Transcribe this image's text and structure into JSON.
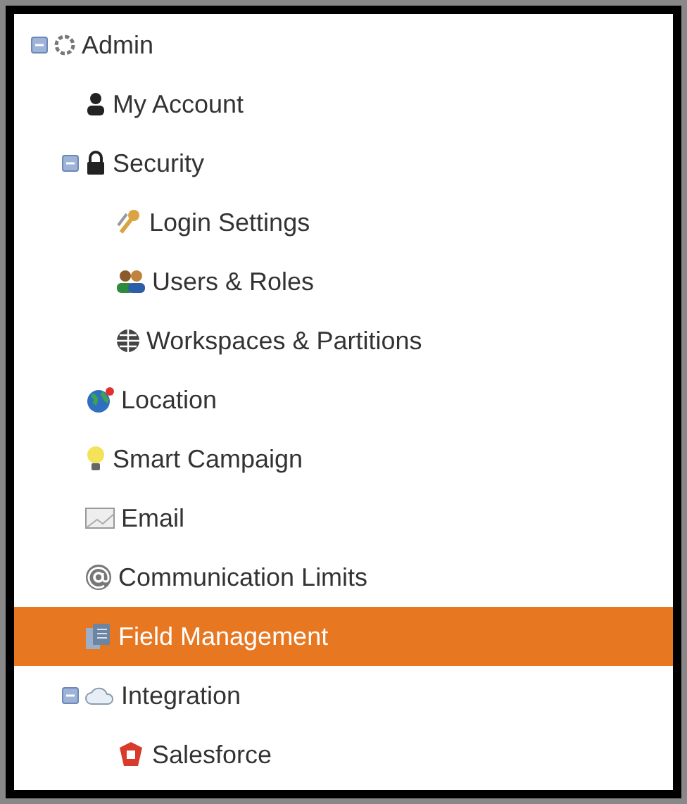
{
  "tree": [
    {
      "label": "Admin",
      "expanded": true,
      "selected": false,
      "children": [
        {
          "label": "My Account",
          "selected": false
        },
        {
          "label": "Security",
          "expanded": true,
          "selected": false,
          "children": [
            {
              "label": "Login Settings",
              "selected": false
            },
            {
              "label": "Users & Roles",
              "selected": false
            },
            {
              "label": "Workspaces & Partitions",
              "selected": false
            }
          ]
        },
        {
          "label": "Location",
          "selected": false
        },
        {
          "label": "Smart Campaign",
          "selected": false
        },
        {
          "label": "Email",
          "selected": false
        },
        {
          "label": "Communication Limits",
          "selected": false
        },
        {
          "label": "Field Management",
          "selected": true
        },
        {
          "label": "Integration",
          "expanded": true,
          "selected": false,
          "children": [
            {
              "label": "Salesforce",
              "selected": false
            }
          ]
        }
      ]
    }
  ]
}
